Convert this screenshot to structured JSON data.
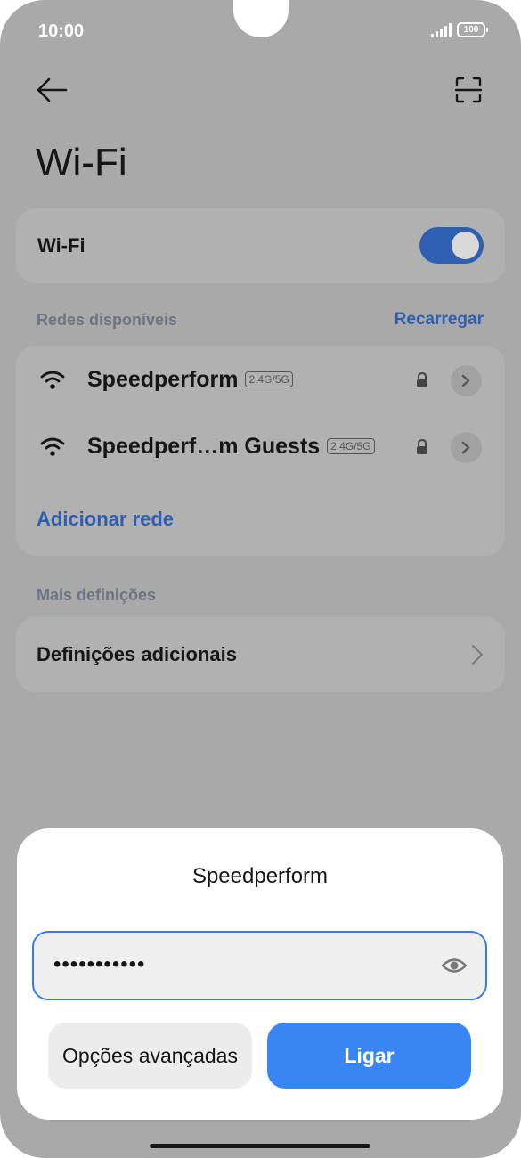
{
  "status_bar": {
    "time": "10:00",
    "battery": "100",
    "icons": [
      "signal-icon",
      "battery-icon"
    ]
  },
  "header": {
    "back_icon": "arrow-left-icon",
    "scan_icon": "qr-scan-icon",
    "title": "Wi-Fi"
  },
  "wifi_toggle": {
    "label": "Wi-Fi",
    "on": true,
    "accent_color": "#2f5fb2"
  },
  "available_networks": {
    "section_label": "Redes disponíveis",
    "refresh_label": "Recarregar",
    "networks": [
      {
        "name": "Speedperform",
        "band": "2.4G/5G",
        "secured": true
      },
      {
        "name": "Speedperf…m Guests",
        "band": "2.4G/5G",
        "secured": true
      }
    ],
    "add_network_label": "Adicionar rede"
  },
  "more_settings": {
    "section_label": "Mais definições",
    "items": [
      {
        "label": "Definições adicionais"
      }
    ]
  },
  "password_dialog": {
    "title": "Speedperform",
    "password_value": "•••••••••••",
    "advanced_label": "Opções avançadas",
    "connect_label": "Ligar",
    "connect_color": "#3985f4"
  }
}
